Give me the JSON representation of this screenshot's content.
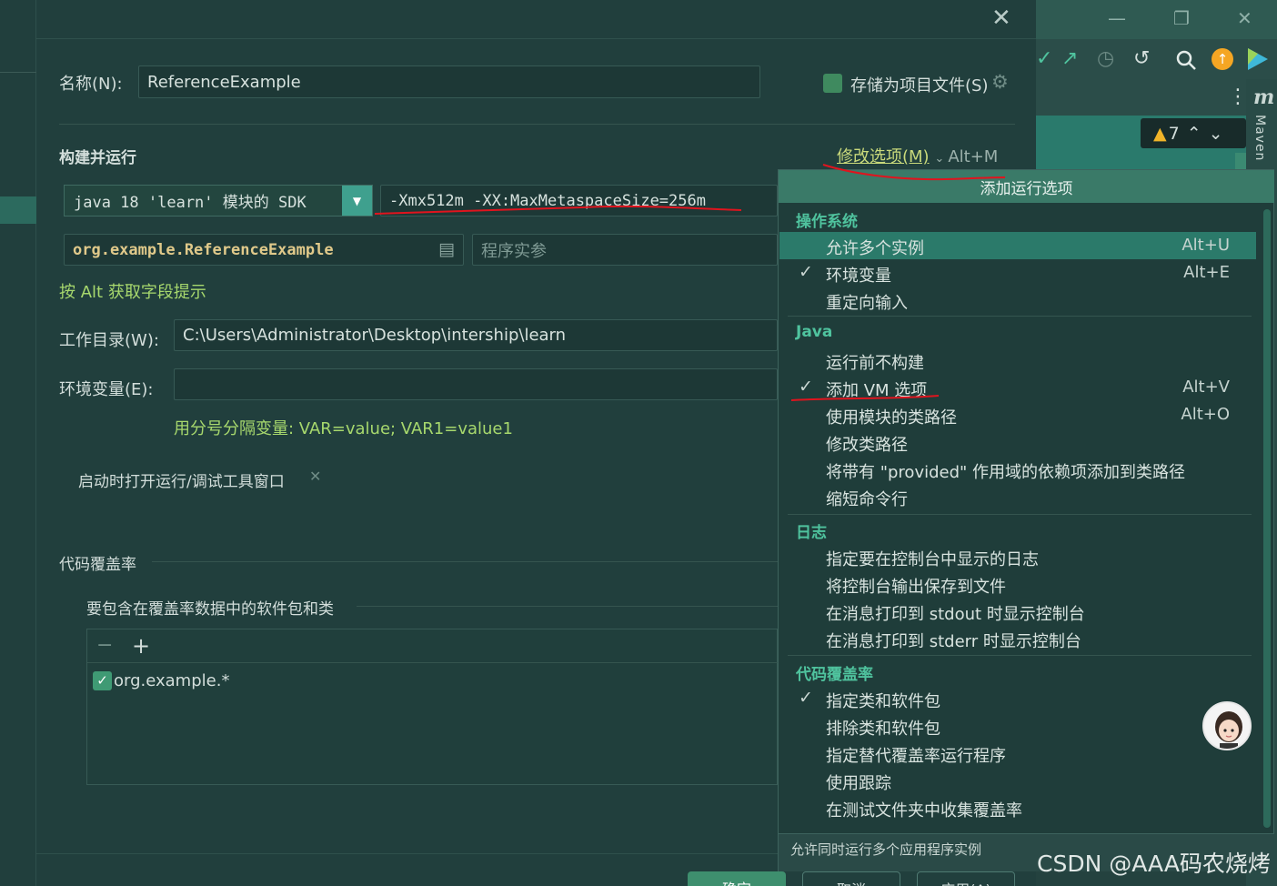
{
  "window": {
    "close_icon": "close-icon"
  },
  "ide": {
    "inspection_count": "7",
    "tool_window_label": "Maven",
    "tool_window_icon": "m"
  },
  "form": {
    "name_label": "名称(N):",
    "name_value": "ReferenceExample",
    "store_label": "存储为项目文件(S)",
    "build_run_title": "构建并运行",
    "modify_options": "修改选项(M)",
    "modify_shortcut": "Alt+M",
    "sdk_value": "java 18 'learn' 模块的 SDK",
    "vm_options": "-Xmx512m -XX:MaxMetaspaceSize=256m",
    "main_class": "org.example.ReferenceExample",
    "program_args_placeholder": "程序实参",
    "alt_hint": "按 Alt 获取字段提示",
    "workdir_label": "工作目录(W):",
    "workdir_value": "C:\\Users\\Administrator\\Desktop\\intership\\learn",
    "env_label": "环境变量(E):",
    "env_value": "",
    "env_hint": "用分号分隔变量: VAR=value; VAR1=value1",
    "open_tool_window": "启动时打开运行/调试工具窗口",
    "coverage_title": "代码覆盖率",
    "coverage_sub": "要包含在覆盖率数据中的软件包和类",
    "coverage_item": "org.example.*"
  },
  "popup": {
    "header": "添加运行选项",
    "os_section": "操作系统",
    "os_items": [
      {
        "label": "允许多个实例",
        "shortcut": "Alt+U",
        "checked": false
      },
      {
        "label": "环境变量",
        "shortcut": "Alt+E",
        "checked": true
      },
      {
        "label": "重定向输入",
        "shortcut": "",
        "checked": false
      }
    ],
    "java_section": "Java",
    "java_items": [
      {
        "label": "运行前不构建",
        "shortcut": "",
        "checked": false
      },
      {
        "label": "添加 VM 选项",
        "shortcut": "Alt+V",
        "checked": true
      },
      {
        "label": "使用模块的类路径",
        "shortcut": "Alt+O",
        "checked": false
      },
      {
        "label": "修改类路径",
        "shortcut": "",
        "checked": false
      },
      {
        "label": "将带有 \"provided\" 作用域的依赖项添加到类路径",
        "shortcut": "",
        "checked": false
      },
      {
        "label": "缩短命令行",
        "shortcut": "",
        "checked": false
      }
    ],
    "log_section": "日志",
    "log_items": [
      {
        "label": "指定要在控制台中显示的日志"
      },
      {
        "label": "将控制台输出保存到文件"
      },
      {
        "label": "在消息打印到 stdout 时显示控制台"
      },
      {
        "label": "在消息打印到 stderr 时显示控制台"
      }
    ],
    "coverage_section": "代码覆盖率",
    "coverage_items": [
      {
        "label": "指定类和软件包",
        "checked": true
      },
      {
        "label": "排除类和软件包",
        "checked": false
      },
      {
        "label": "指定替代覆盖率运行程序",
        "checked": false
      },
      {
        "label": "使用跟踪",
        "checked": false
      },
      {
        "label": "在测试文件夹中收集覆盖率",
        "checked": false
      }
    ],
    "footer": "允许同时运行多个应用程序实例",
    "check_glyph": "✓"
  },
  "buttons": {
    "ok": "确定",
    "cancel": "取消",
    "apply": "应用(A)"
  },
  "watermark": "CSDN @AAA码农烧烤",
  "colors": {
    "accent": "#4fc39e",
    "link": "#c9d97b",
    "hint": "#a7d86d",
    "annotation": "#e0141e",
    "selected": "#2b7a6a"
  }
}
